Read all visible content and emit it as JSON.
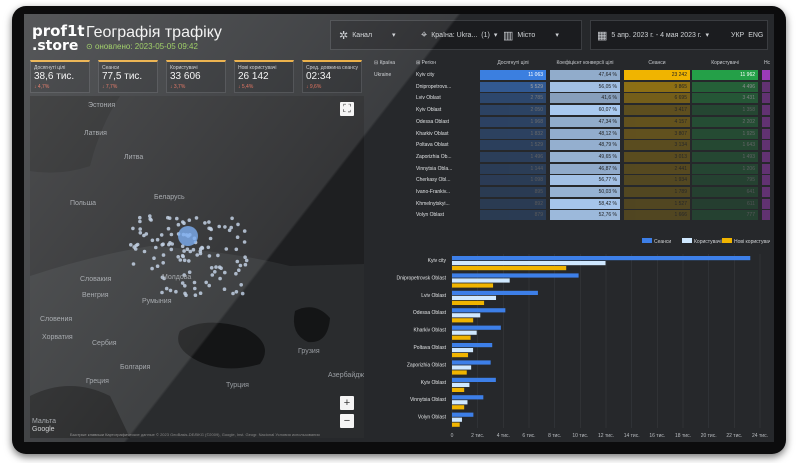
{
  "logo": {
    "line1": "prof1t",
    "line2": ".store"
  },
  "header": {
    "title": "Географія трафіку",
    "updated": "оновлено: 2023-05-05 09:42"
  },
  "filters": {
    "channel_label": "Канал",
    "country_label": "Країна: Ukra...",
    "country_count": "(1)",
    "city_label": "Місто",
    "date_range": "5 апр. 2023 г. - 4 мая 2023 г.",
    "lang_uk": "УКР",
    "lang_en": "ENG"
  },
  "kpis": [
    {
      "label": "Досягнуті цілі",
      "value": "38,6 тис.",
      "change": "↓ 4,7%",
      "color": "#e0604a"
    },
    {
      "label": "Сеанси",
      "value": "77,5 тис.",
      "change": "↓ 7,7%",
      "color": "#e0604a"
    },
    {
      "label": "Користувачі",
      "value": "33 606",
      "change": "↓ 3,7%",
      "color": "#e0604a"
    },
    {
      "label": "Нові користувачі",
      "value": "26 142",
      "change": "↓ 5,4%",
      "color": "#e0604a"
    },
    {
      "label": "Сред. довжина сеансу",
      "value": "02:34",
      "change": "↓ 9,6%",
      "color": "#e0604a"
    }
  ],
  "map": {
    "labels": [
      "Эстония",
      "Латвия",
      "Литва",
      "Беларусь",
      "Польша",
      "Словакия",
      "Молдова",
      "Венгрия",
      "Румыния",
      "Словения",
      "Хорватия",
      "Сербия",
      "Болгария",
      "Греция",
      "Турция",
      "Грузия",
      "Азербайджан",
      "Мальта"
    ],
    "footer": [
      "Быстрые клавиши",
      "Картографические данные © 2023 GeoBasis-DE/BKG (©2009), Google, Inst. Geogr. Nacional",
      "Условия использования"
    ],
    "zoom_in": "+",
    "zoom_out": "−",
    "fullscreen": "⛶",
    "google_label": "Google"
  },
  "table": {
    "col_country": "Країна",
    "col_region": "Регіон",
    "columns": [
      "Досягнуті цілі",
      "Коефіцієнт конверсії цілі",
      "Сеанси",
      "Користувачі",
      "Нс"
    ],
    "country": "Ukraine",
    "rows": [
      {
        "region": "Kyiv city",
        "goals": "11 063",
        "conv": "47,64 %",
        "sessions": "23 242",
        "users": "11 962"
      },
      {
        "region": "Dnipropetrovs...",
        "goals": "5 529",
        "conv": "56,05 %",
        "sessions": "9 865",
        "users": "4 496"
      },
      {
        "region": "Lviv Oblast",
        "goals": "2 785",
        "conv": "41,6 %",
        "sessions": "6 695",
        "users": "3 431"
      },
      {
        "region": "Kyiv Oblast",
        "goals": "2 050",
        "conv": "60,07 %",
        "sessions": "3 417",
        "users": "1 358"
      },
      {
        "region": "Odessa Oblast",
        "goals": "1 968",
        "conv": "47,34 %",
        "sessions": "4 157",
        "users": "2 202"
      },
      {
        "region": "Kharkiv Oblast",
        "goals": "1 832",
        "conv": "48,12 %",
        "sessions": "3 807",
        "users": "1 925"
      },
      {
        "region": "Poltava Oblast",
        "goals": "1 529",
        "conv": "48,79 %",
        "sessions": "3 134",
        "users": "1 643"
      },
      {
        "region": "Zaporizhia Ob...",
        "goals": "1 496",
        "conv": "49,65 %",
        "sessions": "3 013",
        "users": "1 493"
      },
      {
        "region": "Vinnytsia Obla...",
        "goals": "1 144",
        "conv": "46,87 %",
        "sessions": "2 441",
        "users": "1 206"
      },
      {
        "region": "Cherkasy Obl...",
        "goals": "1 098",
        "conv": "56,77 %",
        "sessions": "1 934",
        "users": "795"
      },
      {
        "region": "Ivano-Frankiv...",
        "goals": "895",
        "conv": "50,03 %",
        "sessions": "1 789",
        "users": "641"
      },
      {
        "region": "Khmelnytskyi...",
        "goals": "892",
        "conv": "58,42 %",
        "sessions": "1 527",
        "users": "611"
      },
      {
        "region": "Volyn Oblast",
        "goals": "879",
        "conv": "52,76 %",
        "sessions": "1 666",
        "users": "777"
      }
    ]
  },
  "chart_data": {
    "type": "bar",
    "orientation": "horizontal",
    "categories": [
      "Kyiv city",
      "Dnipropetrovsk Oblast",
      "Lviv Oblast",
      "Odessa Oblast",
      "Kharkiv Oblast",
      "Poltava Oblast",
      "Zaporizhia Oblast",
      "Kyiv Oblast",
      "Vinnytsia Oblast",
      "Volyn Oblast"
    ],
    "series": [
      {
        "name": "Сеанси",
        "color": "#3d7fe8",
        "values": [
          23242,
          9865,
          6695,
          4157,
          3807,
          3134,
          3013,
          3417,
          2441,
          1666
        ]
      },
      {
        "name": "Користувачі",
        "color": "#cfe8ff",
        "values": [
          11962,
          4496,
          3431,
          2202,
          1925,
          1643,
          1493,
          1358,
          1206,
          777
        ]
      },
      {
        "name": "Нові користувачі",
        "color": "#f0b400",
        "values": [
          8900,
          3200,
          2500,
          1650,
          1450,
          1250,
          1150,
          950,
          950,
          600
        ]
      }
    ],
    "xticks": [
      "0",
      "2 тис.",
      "4 тис.",
      "6 тис.",
      "8 тис.",
      "10 тис.",
      "12 тис.",
      "14 тис.",
      "16 тис.",
      "18 тис.",
      "20 тис.",
      "22 тис.",
      "24 тис."
    ],
    "xlim": [
      0,
      24000
    ],
    "legend": "top-right"
  }
}
